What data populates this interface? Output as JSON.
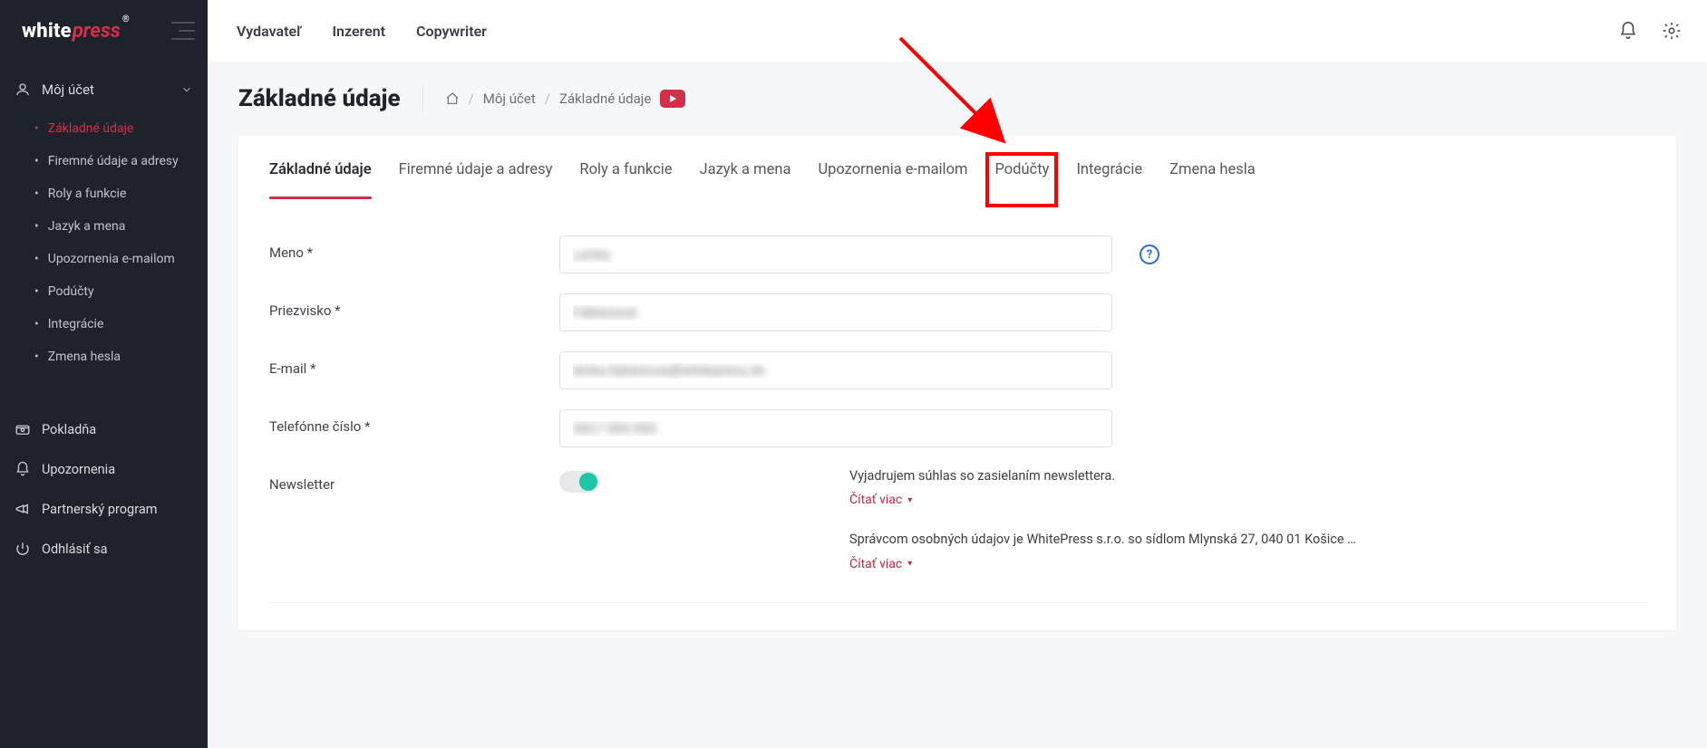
{
  "brand": {
    "white": "white",
    "press": "press",
    "reg": "®"
  },
  "topnav": {
    "tabs": [
      "Vydavateľ",
      "Inzerent",
      "Copywriter"
    ]
  },
  "sidebar": {
    "account": {
      "label": "Môj účet"
    },
    "sub": [
      "Základné údaje",
      "Firemné údaje a adresy",
      "Roly a funkcie",
      "Jazyk a mena",
      "Upozornenia e-mailom",
      "Podúčty",
      "Integrácie",
      "Zmena hesla"
    ],
    "secondary": [
      "Pokladňa",
      "Upozornenia",
      "Partnerský program",
      "Odhlásiť sa"
    ]
  },
  "header": {
    "title": "Základné údaje",
    "crumb1": "Môj účet",
    "crumb2": "Základné údaje"
  },
  "tabs": [
    "Základné údaje",
    "Firemné údaje a adresy",
    "Roly a funkcie",
    "Jazyk a mena",
    "Upozornenia e-mailom",
    "Podúčty",
    "Integrácie",
    "Zmena hesla"
  ],
  "form": {
    "name_label": "Meno *",
    "name_value": "Lenka",
    "surname_label": "Priezvisko *",
    "surname_value": "Fábianová",
    "email_label": "E-mail *",
    "email_value": "lenka.fabianova@whitepress.sk",
    "phone_label": "Telefónne číslo *",
    "phone_value": "0917 000 000",
    "newsletter_label": "Newsletter",
    "consent1": "Vyjadrujem súhlas so zasielaním newslettera.",
    "consent2": "Správcom osobných údajov je WhitePress s.r.o. so sídlom Mlynská 27, 040 01 Košice …",
    "read_more": "Čítať viac",
    "help": "?"
  }
}
